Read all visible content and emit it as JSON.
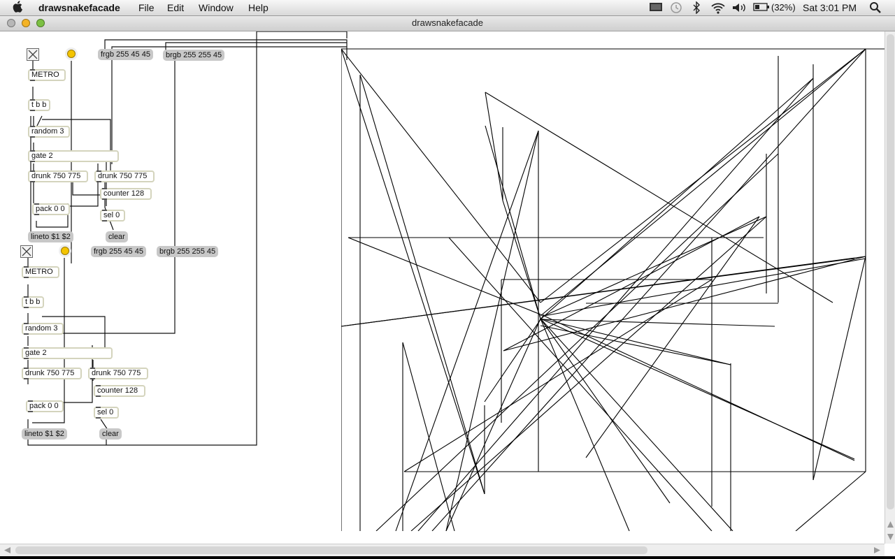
{
  "menubar": {
    "app_name": "drawsnakefacade",
    "menus": [
      "File",
      "Edit",
      "Window",
      "Help"
    ],
    "battery": "(32%)",
    "clock": "Sat 3:01 PM"
  },
  "window": {
    "title": "drawsnakefacade"
  },
  "patch": {
    "top": {
      "metro": "METRO",
      "tbb": "t b b",
      "random": "random 3",
      "gate": "gate 2",
      "drunk_a": "drunk 750 775",
      "drunk_b": "drunk 750 775",
      "counter": "counter 128",
      "pack": "pack 0 0",
      "sel": "sel 0",
      "lineto": "lineto $1 $2",
      "clear": "clear",
      "frgb": "frgb 255 45 45",
      "brgb": "brgb 255 255 45"
    },
    "bottom": {
      "metro": "METRO",
      "tbb": "t b b",
      "random": "random 3",
      "gate": "gate 2",
      "drunk_a": "drunk 750 775",
      "drunk_b": "drunk 750 775",
      "counter": "counter 128",
      "pack": "pack 0 0",
      "sel": "sel 0",
      "lineto": "lineto $1 $2",
      "clear": "clear",
      "frgb": "frgb 255 45 45",
      "brgb": "brgb 255 255 45"
    }
  },
  "colors": {
    "canvas": "#ffffff",
    "lines": "#000000",
    "bang": "#f4c400"
  }
}
